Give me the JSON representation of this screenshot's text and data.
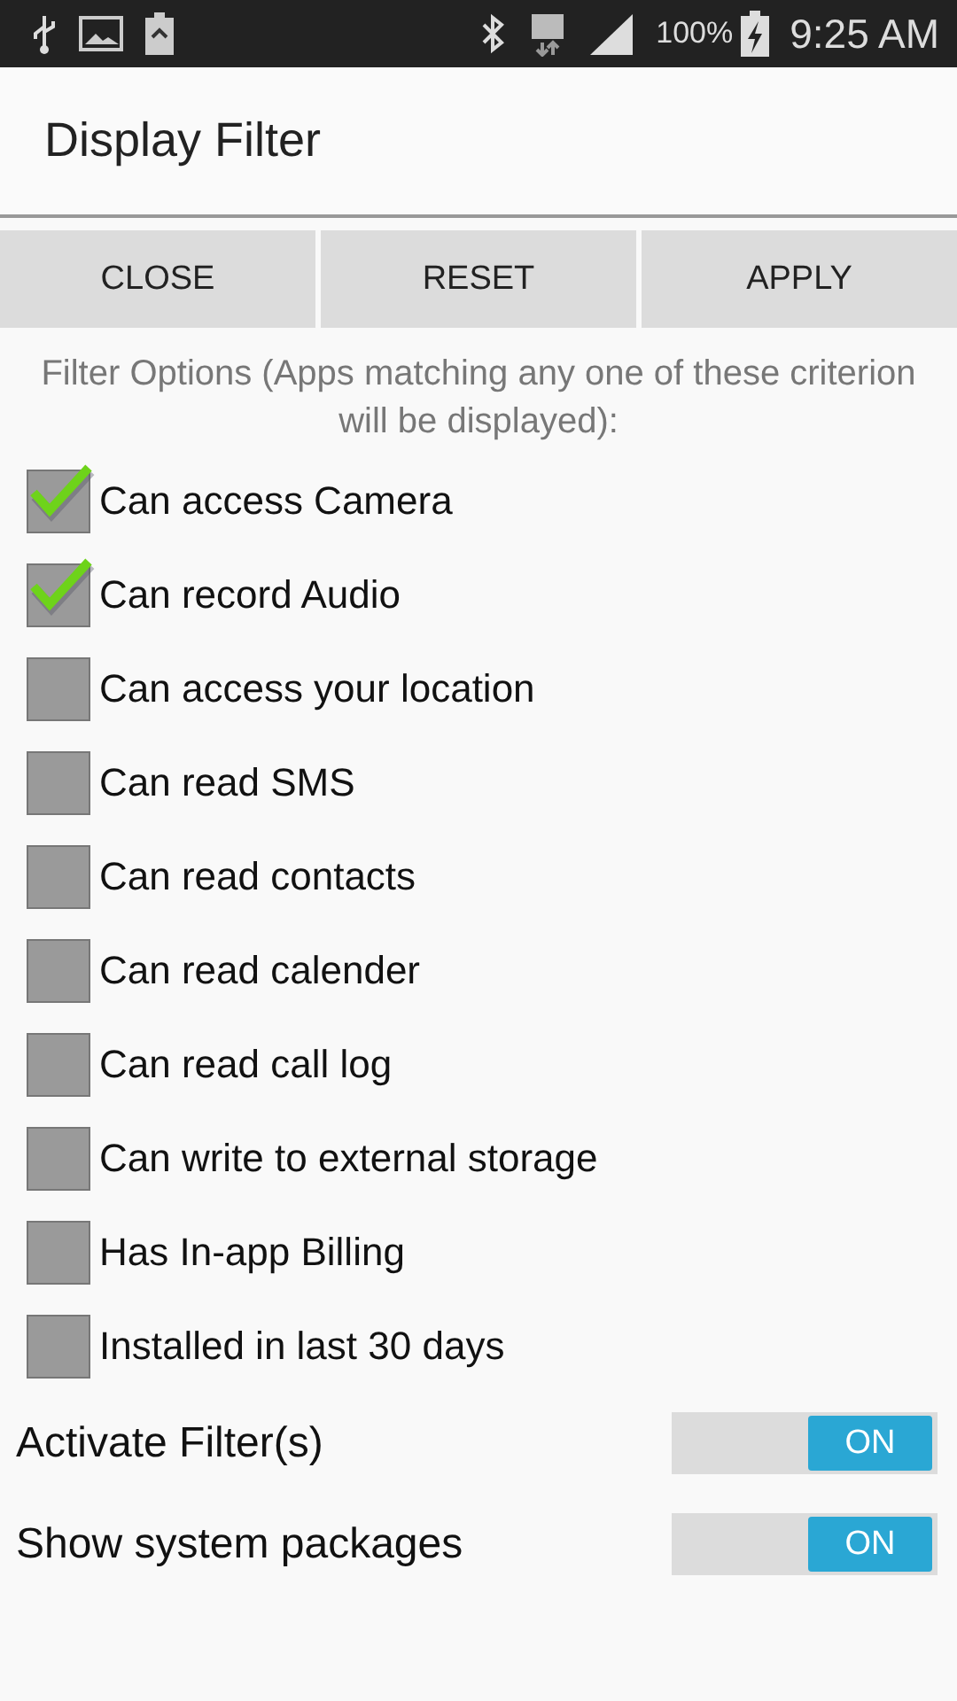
{
  "status_bar": {
    "battery": "100%",
    "time": "9:25 AM"
  },
  "title": "Display Filter",
  "buttons": [
    "CLOSE",
    "RESET",
    "APPLY"
  ],
  "intro": "Filter Options (Apps matching any one of these criterion will be displayed):",
  "options": [
    {
      "label": "Can access Camera",
      "checked": true
    },
    {
      "label": "Can record Audio",
      "checked": true
    },
    {
      "label": "Can access your location",
      "checked": false
    },
    {
      "label": "Can read SMS",
      "checked": false
    },
    {
      "label": "Can read contacts",
      "checked": false
    },
    {
      "label": "Can read calender",
      "checked": false
    },
    {
      "label": "Can read call log",
      "checked": false
    },
    {
      "label": "Can write to external storage",
      "checked": false
    },
    {
      "label": "Has In-app Billing",
      "checked": false
    },
    {
      "label": "Installed in last 30 days",
      "checked": false
    }
  ],
  "switches": [
    {
      "label": "Activate Filter(s)",
      "on": true,
      "state_text": "ON"
    },
    {
      "label": "Show system packages",
      "on": true,
      "state_text": "ON"
    }
  ]
}
